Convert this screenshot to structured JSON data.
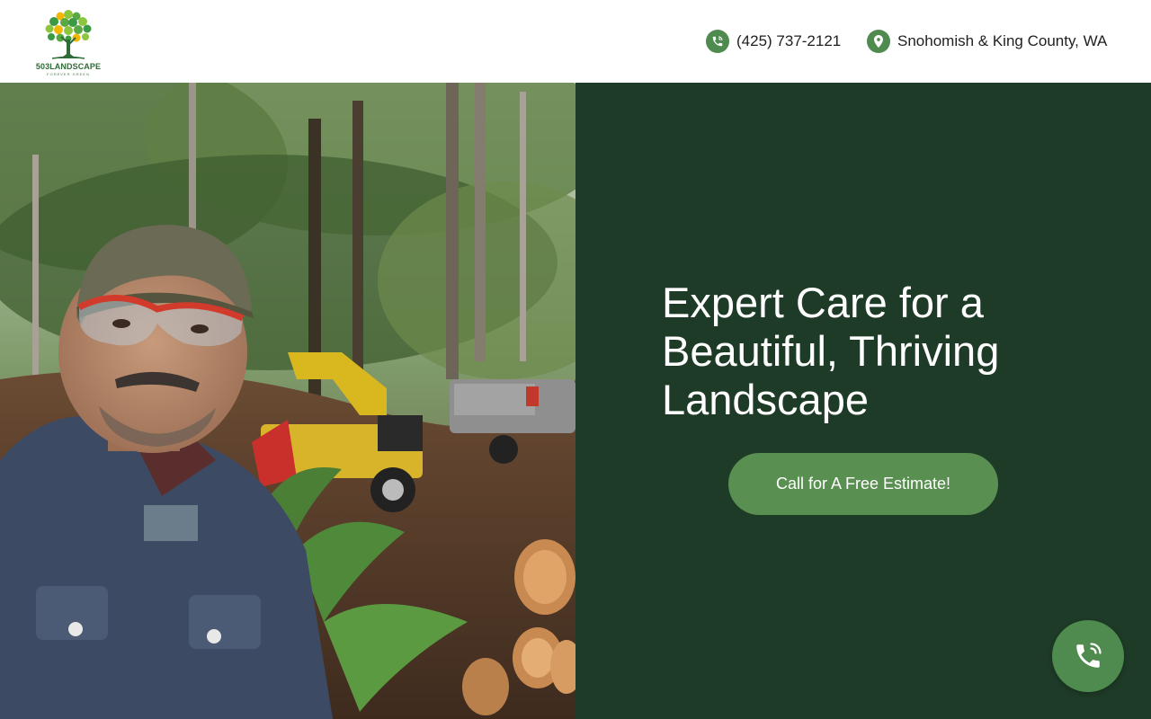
{
  "header": {
    "logo": {
      "brand": "503LANDSCAPE",
      "tagline": "FOREVER GREEN",
      "icon": "tree-logo-icon"
    },
    "phone": {
      "icon": "phone-icon",
      "label": "(425) 737-2121"
    },
    "location": {
      "icon": "map-pin-icon",
      "label": "Snohomish & King County, WA"
    }
  },
  "hero": {
    "photo_alt": "Landscaper selfie in forest with wood chipper and pickup truck",
    "title": "Expert Care for a Beautiful, Thriving Landscape",
    "cta_label": "Call for A Free Estimate!"
  },
  "floating_call": {
    "icon": "phone-call-icon"
  },
  "colors": {
    "brand_green": "#4f8a4f",
    "panel_dark_green": "#1e3b27",
    "button_green": "#5a8f52",
    "text_dark": "#1f1f1f"
  }
}
